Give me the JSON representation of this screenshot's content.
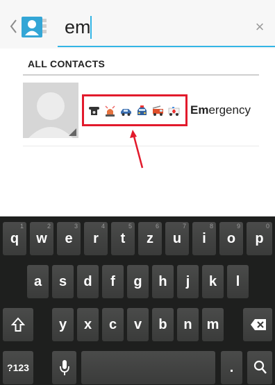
{
  "search": {
    "query": "em",
    "clear_glyph": "×"
  },
  "section": {
    "header": "ALL CONTACTS"
  },
  "contact": {
    "emoji_icons": [
      "telephone-icon",
      "police-light-icon",
      "police-car-icon",
      "police-car-front-icon",
      "fire-truck-icon",
      "ambulance-icon"
    ],
    "name_highlight": "Em",
    "name_rest": "ergency"
  },
  "colors": {
    "accent": "#33b5e5",
    "highlight_box": "#e21a2c",
    "keyboard_bg": "#1e1f1e",
    "key_bg": "#444544"
  },
  "keyboard": {
    "row1": [
      {
        "label": "q",
        "hint": "1"
      },
      {
        "label": "w",
        "hint": "2"
      },
      {
        "label": "e",
        "hint": "3"
      },
      {
        "label": "r",
        "hint": "4"
      },
      {
        "label": "t",
        "hint": "5"
      },
      {
        "label": "z",
        "hint": "6"
      },
      {
        "label": "u",
        "hint": "7"
      },
      {
        "label": "i",
        "hint": "8"
      },
      {
        "label": "o",
        "hint": "9"
      },
      {
        "label": "p",
        "hint": "0"
      }
    ],
    "row2": [
      "a",
      "s",
      "d",
      "f",
      "g",
      "h",
      "j",
      "k",
      "l"
    ],
    "row3": [
      "y",
      "x",
      "c",
      "v",
      "b",
      "n",
      "m"
    ],
    "symbols_label": "?123",
    "period_label": ".",
    "shift_icon": "shift-icon",
    "delete_icon": "backspace-icon",
    "mic_icon": "microphone-icon",
    "search_icon": "search-icon"
  }
}
